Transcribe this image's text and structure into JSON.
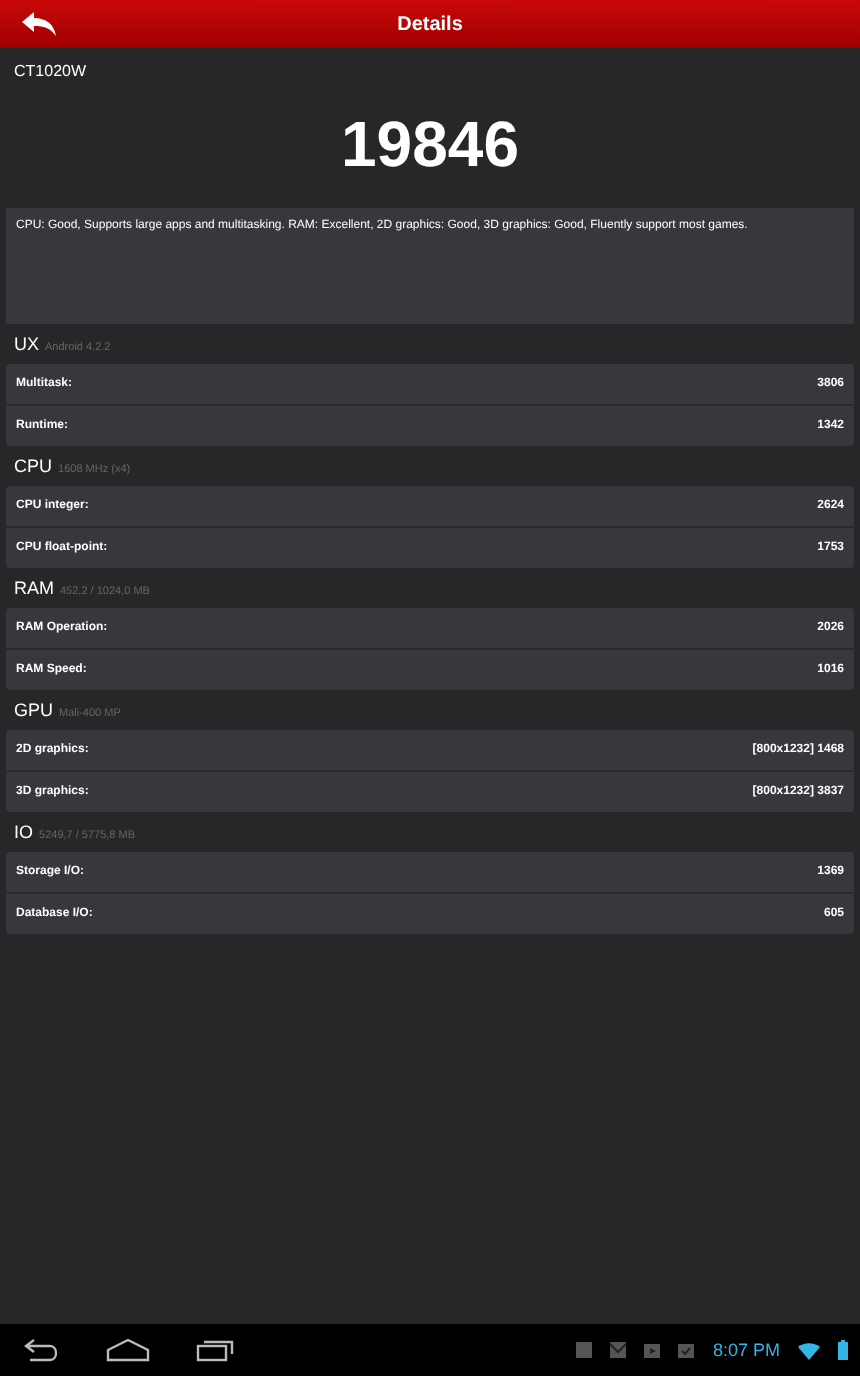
{
  "header": {
    "title": "Details"
  },
  "device": "CT1020W",
  "score": "19846",
  "summary": "CPU: Good, Supports large apps and multitasking. RAM: Excellent, 2D graphics: Good, 3D graphics: Good, Fluently support most games.",
  "sections": [
    {
      "name": "UX",
      "detail": "Android 4.2.2",
      "rows": [
        {
          "label": "Multitask:",
          "value": "3806"
        },
        {
          "label": "Runtime:",
          "value": "1342"
        }
      ]
    },
    {
      "name": "CPU",
      "detail": "1608 MHz (x4)",
      "rows": [
        {
          "label": "CPU integer:",
          "value": "2624"
        },
        {
          "label": "CPU float-point:",
          "value": "1753"
        }
      ]
    },
    {
      "name": "RAM",
      "detail": "452,2 / 1024,0 MB",
      "rows": [
        {
          "label": "RAM Operation:",
          "value": "2026"
        },
        {
          "label": "RAM Speed:",
          "value": "1016"
        }
      ]
    },
    {
      "name": "GPU",
      "detail": "Mali-400 MP",
      "rows": [
        {
          "label": "2D graphics:",
          "value": "[800x1232] 1468"
        },
        {
          "label": "3D graphics:",
          "value": "[800x1232] 3837"
        }
      ]
    },
    {
      "name": "IO",
      "detail": "5249,7 / 5775,8 MB",
      "rows": [
        {
          "label": "Storage I/O:",
          "value": "1369"
        },
        {
          "label": "Database I/O:",
          "value": "605"
        }
      ]
    }
  ],
  "status_bar": {
    "time": "8:07 PM"
  }
}
